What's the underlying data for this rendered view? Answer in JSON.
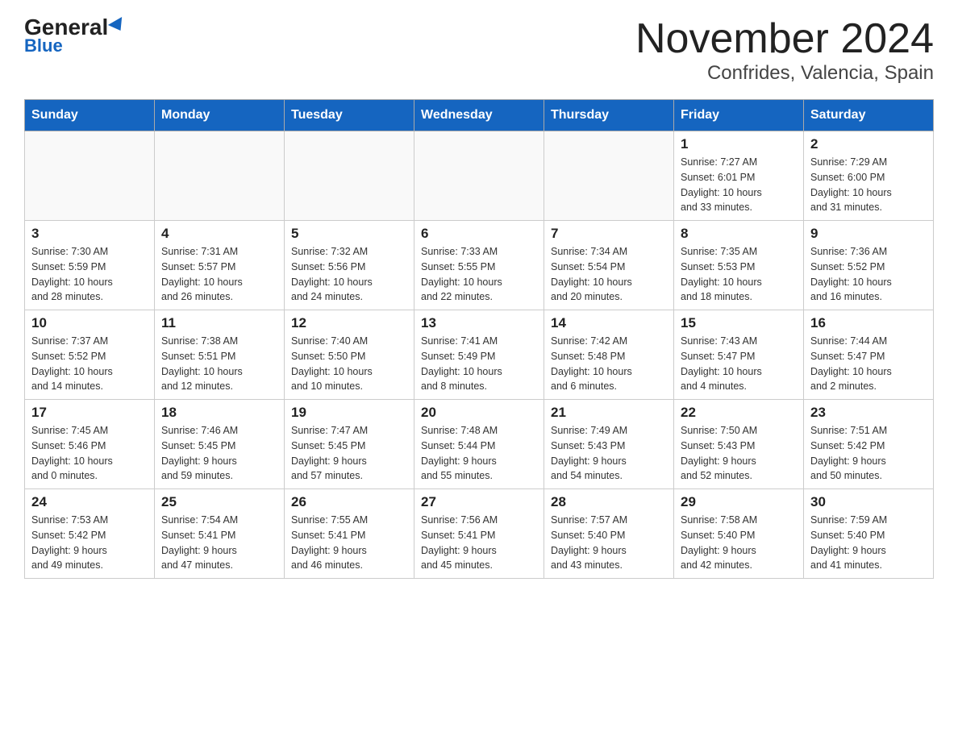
{
  "header": {
    "logo_general": "General",
    "logo_blue": "Blue",
    "title": "November 2024",
    "subtitle": "Confrides, Valencia, Spain"
  },
  "calendar": {
    "weekdays": [
      "Sunday",
      "Monday",
      "Tuesday",
      "Wednesday",
      "Thursday",
      "Friday",
      "Saturday"
    ],
    "weeks": [
      [
        {
          "day": "",
          "info": ""
        },
        {
          "day": "",
          "info": ""
        },
        {
          "day": "",
          "info": ""
        },
        {
          "day": "",
          "info": ""
        },
        {
          "day": "",
          "info": ""
        },
        {
          "day": "1",
          "info": "Sunrise: 7:27 AM\nSunset: 6:01 PM\nDaylight: 10 hours\nand 33 minutes."
        },
        {
          "day": "2",
          "info": "Sunrise: 7:29 AM\nSunset: 6:00 PM\nDaylight: 10 hours\nand 31 minutes."
        }
      ],
      [
        {
          "day": "3",
          "info": "Sunrise: 7:30 AM\nSunset: 5:59 PM\nDaylight: 10 hours\nand 28 minutes."
        },
        {
          "day": "4",
          "info": "Sunrise: 7:31 AM\nSunset: 5:57 PM\nDaylight: 10 hours\nand 26 minutes."
        },
        {
          "day": "5",
          "info": "Sunrise: 7:32 AM\nSunset: 5:56 PM\nDaylight: 10 hours\nand 24 minutes."
        },
        {
          "day": "6",
          "info": "Sunrise: 7:33 AM\nSunset: 5:55 PM\nDaylight: 10 hours\nand 22 minutes."
        },
        {
          "day": "7",
          "info": "Sunrise: 7:34 AM\nSunset: 5:54 PM\nDaylight: 10 hours\nand 20 minutes."
        },
        {
          "day": "8",
          "info": "Sunrise: 7:35 AM\nSunset: 5:53 PM\nDaylight: 10 hours\nand 18 minutes."
        },
        {
          "day": "9",
          "info": "Sunrise: 7:36 AM\nSunset: 5:52 PM\nDaylight: 10 hours\nand 16 minutes."
        }
      ],
      [
        {
          "day": "10",
          "info": "Sunrise: 7:37 AM\nSunset: 5:52 PM\nDaylight: 10 hours\nand 14 minutes."
        },
        {
          "day": "11",
          "info": "Sunrise: 7:38 AM\nSunset: 5:51 PM\nDaylight: 10 hours\nand 12 minutes."
        },
        {
          "day": "12",
          "info": "Sunrise: 7:40 AM\nSunset: 5:50 PM\nDaylight: 10 hours\nand 10 minutes."
        },
        {
          "day": "13",
          "info": "Sunrise: 7:41 AM\nSunset: 5:49 PM\nDaylight: 10 hours\nand 8 minutes."
        },
        {
          "day": "14",
          "info": "Sunrise: 7:42 AM\nSunset: 5:48 PM\nDaylight: 10 hours\nand 6 minutes."
        },
        {
          "day": "15",
          "info": "Sunrise: 7:43 AM\nSunset: 5:47 PM\nDaylight: 10 hours\nand 4 minutes."
        },
        {
          "day": "16",
          "info": "Sunrise: 7:44 AM\nSunset: 5:47 PM\nDaylight: 10 hours\nand 2 minutes."
        }
      ],
      [
        {
          "day": "17",
          "info": "Sunrise: 7:45 AM\nSunset: 5:46 PM\nDaylight: 10 hours\nand 0 minutes."
        },
        {
          "day": "18",
          "info": "Sunrise: 7:46 AM\nSunset: 5:45 PM\nDaylight: 9 hours\nand 59 minutes."
        },
        {
          "day": "19",
          "info": "Sunrise: 7:47 AM\nSunset: 5:45 PM\nDaylight: 9 hours\nand 57 minutes."
        },
        {
          "day": "20",
          "info": "Sunrise: 7:48 AM\nSunset: 5:44 PM\nDaylight: 9 hours\nand 55 minutes."
        },
        {
          "day": "21",
          "info": "Sunrise: 7:49 AM\nSunset: 5:43 PM\nDaylight: 9 hours\nand 54 minutes."
        },
        {
          "day": "22",
          "info": "Sunrise: 7:50 AM\nSunset: 5:43 PM\nDaylight: 9 hours\nand 52 minutes."
        },
        {
          "day": "23",
          "info": "Sunrise: 7:51 AM\nSunset: 5:42 PM\nDaylight: 9 hours\nand 50 minutes."
        }
      ],
      [
        {
          "day": "24",
          "info": "Sunrise: 7:53 AM\nSunset: 5:42 PM\nDaylight: 9 hours\nand 49 minutes."
        },
        {
          "day": "25",
          "info": "Sunrise: 7:54 AM\nSunset: 5:41 PM\nDaylight: 9 hours\nand 47 minutes."
        },
        {
          "day": "26",
          "info": "Sunrise: 7:55 AM\nSunset: 5:41 PM\nDaylight: 9 hours\nand 46 minutes."
        },
        {
          "day": "27",
          "info": "Sunrise: 7:56 AM\nSunset: 5:41 PM\nDaylight: 9 hours\nand 45 minutes."
        },
        {
          "day": "28",
          "info": "Sunrise: 7:57 AM\nSunset: 5:40 PM\nDaylight: 9 hours\nand 43 minutes."
        },
        {
          "day": "29",
          "info": "Sunrise: 7:58 AM\nSunset: 5:40 PM\nDaylight: 9 hours\nand 42 minutes."
        },
        {
          "day": "30",
          "info": "Sunrise: 7:59 AM\nSunset: 5:40 PM\nDaylight: 9 hours\nand 41 minutes."
        }
      ]
    ]
  }
}
